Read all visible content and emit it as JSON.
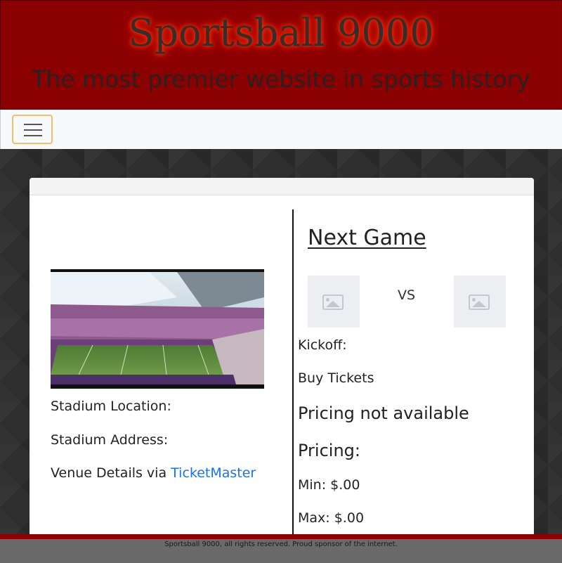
{
  "header": {
    "title": "Sportsball 9000",
    "tagline": "The most premier website in sports history"
  },
  "navbar": {
    "toggler_icon": "hamburger-menu-icon"
  },
  "stadium": {
    "image_icon": "stadium-photo",
    "location_label": "Stadium Location:",
    "address_label": "Stadium Address:",
    "venue_prefix": "Venue Details via ",
    "venue_link": "TicketMaster"
  },
  "next_game": {
    "heading": "Next Game",
    "home_logo_icon": "image-placeholder-icon",
    "away_logo_icon": "image-placeholder-icon",
    "vs": "VS",
    "kickoff_label": "Kickoff:",
    "buy_tickets": "Buy Tickets",
    "pricing_unavailable": "Pricing not available",
    "pricing_heading": "Pricing:",
    "min_label": "Min: $.00",
    "max_label": "Max: $.00"
  },
  "footer": {
    "text": "Sportsball 9000, all rights reserved. Proud sponsor of the internet."
  },
  "colors": {
    "header_bg": "#8b0000",
    "link": "#1a73e8",
    "footer_bg": "#6a6a6a"
  }
}
